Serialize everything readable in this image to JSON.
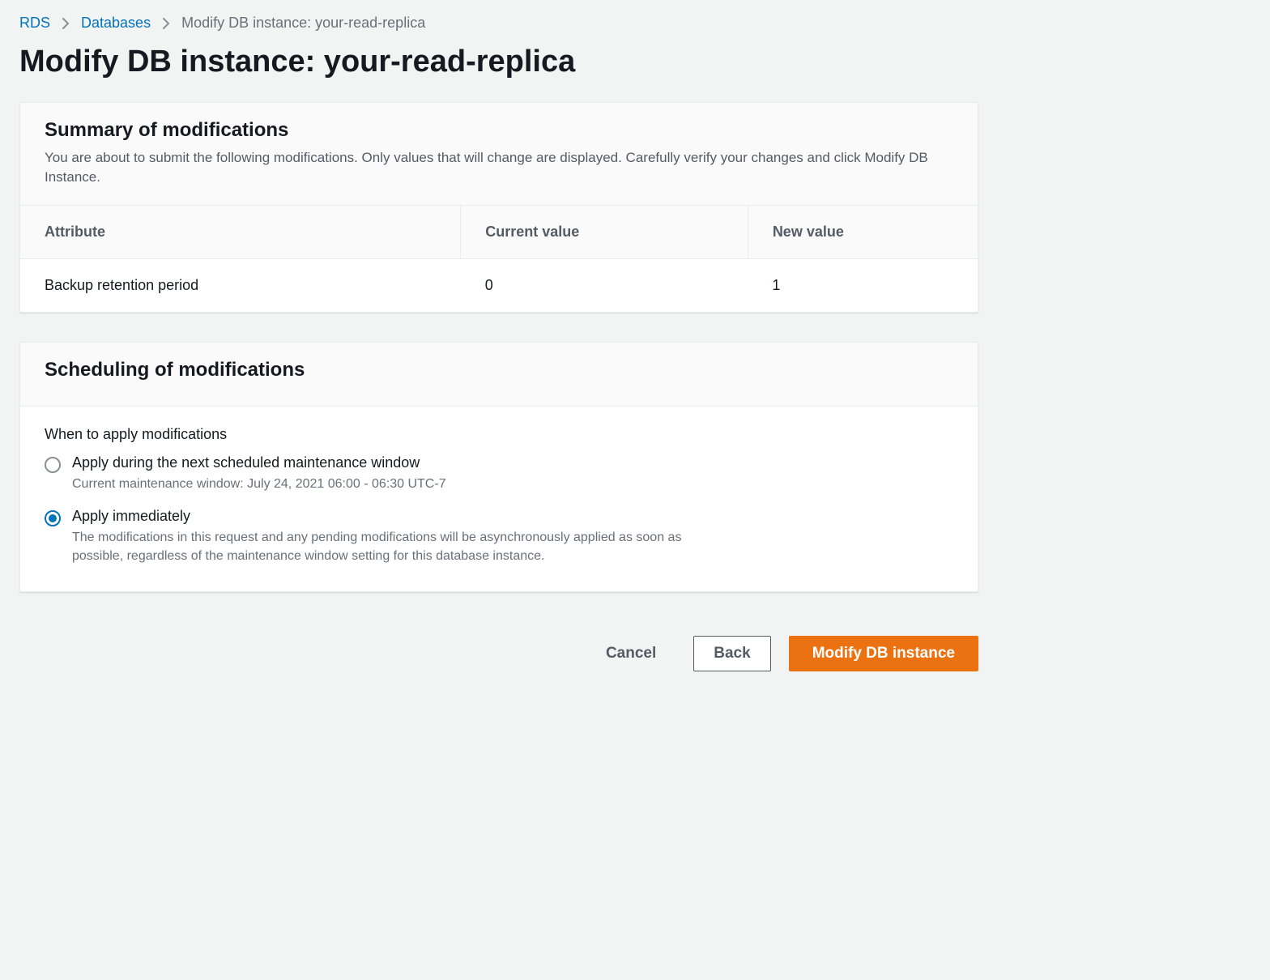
{
  "breadcrumb": {
    "items": [
      "RDS",
      "Databases"
    ],
    "current": "Modify DB instance: your-read-replica"
  },
  "page_title": "Modify DB instance: your-read-replica",
  "summary": {
    "heading": "Summary of modifications",
    "description": "You are about to submit the following modifications. Only values that will change are displayed. Carefully verify your changes and click Modify DB Instance.",
    "columns": [
      "Attribute",
      "Current value",
      "New value"
    ],
    "rows": [
      {
        "attribute": "Backup retention period",
        "current": "0",
        "new": "1"
      }
    ]
  },
  "scheduling": {
    "heading": "Scheduling of modifications",
    "field_label": "When to apply modifications",
    "options": [
      {
        "title": "Apply during the next scheduled maintenance window",
        "desc": "Current maintenance window: July 24, 2021 06:00 - 06:30 UTC-7",
        "selected": false
      },
      {
        "title": "Apply immediately",
        "desc": "The modifications in this request and any pending modifications will be asynchronously applied as soon as possible, regardless of the maintenance window setting for this database instance.",
        "selected": true
      }
    ]
  },
  "actions": {
    "cancel": "Cancel",
    "back": "Back",
    "submit": "Modify DB instance"
  }
}
